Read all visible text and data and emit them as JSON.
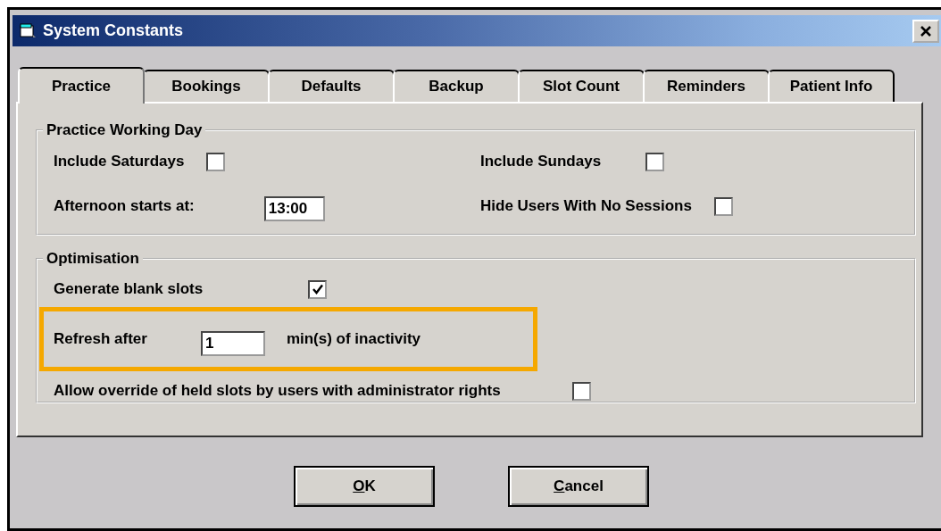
{
  "window": {
    "title": "System Constants"
  },
  "tabs": [
    {
      "label": "Practice",
      "selected": true
    },
    {
      "label": "Bookings",
      "selected": false
    },
    {
      "label": "Defaults",
      "selected": false
    },
    {
      "label": "Backup",
      "selected": false
    },
    {
      "label": "Slot Count",
      "selected": false
    },
    {
      "label": "Reminders",
      "selected": false
    },
    {
      "label": "Patient Info",
      "selected": false
    }
  ],
  "groups": [
    {
      "title": "Practice Working Day",
      "items": [
        {
          "kind": "checkbox",
          "label": "Include Saturdays",
          "checked": false
        },
        {
          "kind": "checkbox",
          "label": "Include Sundays",
          "checked": false
        },
        {
          "kind": "field",
          "label": "Afternoon starts at:",
          "value": "13:00"
        },
        {
          "kind": "checkbox",
          "label": "Hide Users With No Sessions",
          "checked": false
        }
      ]
    },
    {
      "title": "Optimisation",
      "items": [
        {
          "kind": "checkbox",
          "label": "Generate blank slots",
          "checked": true
        },
        {
          "kind": "field",
          "label": "Refresh after",
          "value": "1",
          "suffix": "min(s) of inactivity",
          "highlighted": true
        },
        {
          "kind": "checkbox",
          "label": "Allow override of held slots by users with administrator rights",
          "checked": false
        }
      ]
    }
  ],
  "buttons": [
    {
      "access_key": "O",
      "rest": "K"
    },
    {
      "access_key": "C",
      "rest": "ancel"
    }
  ]
}
